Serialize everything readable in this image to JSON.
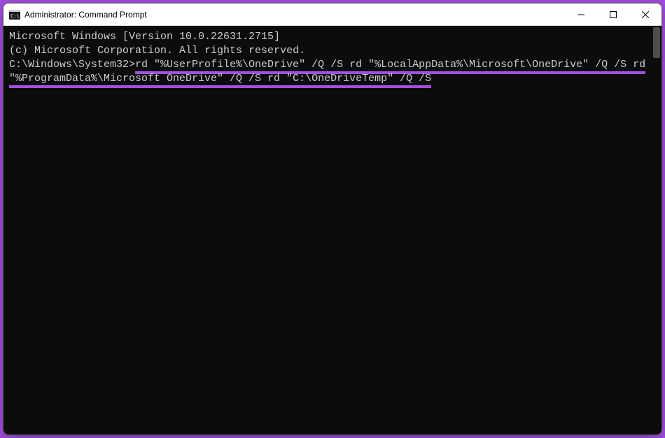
{
  "titlebar": {
    "title": "Administrator: Command Prompt"
  },
  "terminal": {
    "line1": "Microsoft Windows [Version 10.0.22631.2715]",
    "line2": "(c) Microsoft Corporation. All rights reserved.",
    "blank": "",
    "prompt": "C:\\Windows\\System32>",
    "cmd_part1": "rd \"%UserProfile%\\OneDrive\" /Q /S rd \"%LocalAppData%\\Microsoft\\OneDrive\" /Q /S rd",
    "cmd_part2": "\"%ProgramData%\\Microsoft OneDrive\" /Q /S rd \"C:\\OneDriveTemp\" /Q /S"
  }
}
